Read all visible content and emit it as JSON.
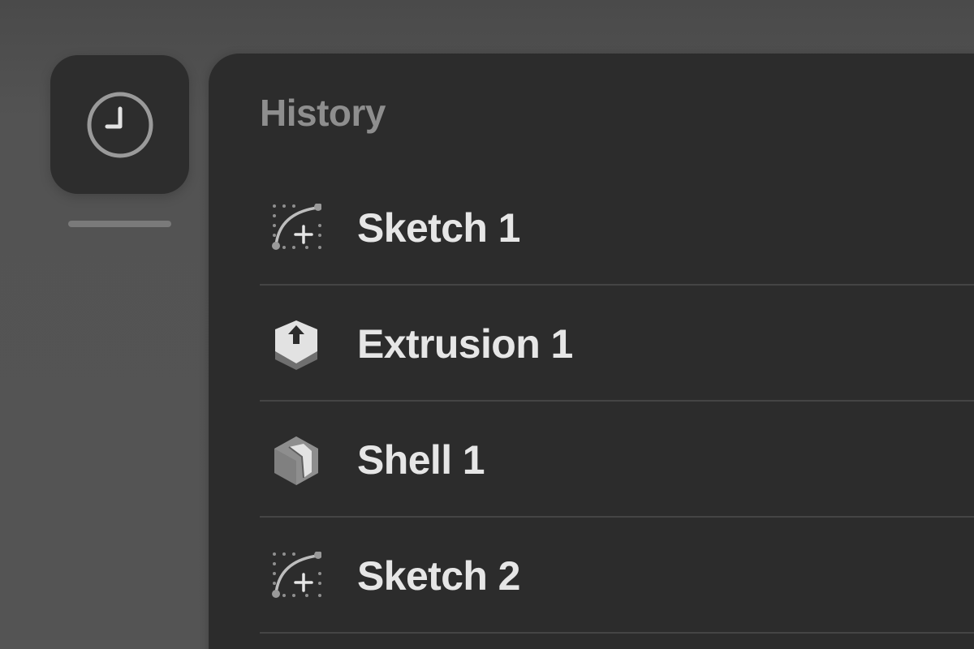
{
  "sidebar": {
    "history_button_icon": "clock-icon"
  },
  "panel": {
    "title": "History",
    "items": [
      {
        "label": "Sketch 1",
        "icon": "sketch-icon"
      },
      {
        "label": "Extrusion 1",
        "icon": "extrusion-icon"
      },
      {
        "label": "Shell 1",
        "icon": "shell-icon"
      },
      {
        "label": "Sketch 2",
        "icon": "sketch-icon"
      }
    ]
  },
  "colors": {
    "background": "#535353",
    "panel": "#2c2c2c",
    "title_text": "#8e8e8e",
    "item_text": "#e6e6e6",
    "divider": "#454545"
  }
}
